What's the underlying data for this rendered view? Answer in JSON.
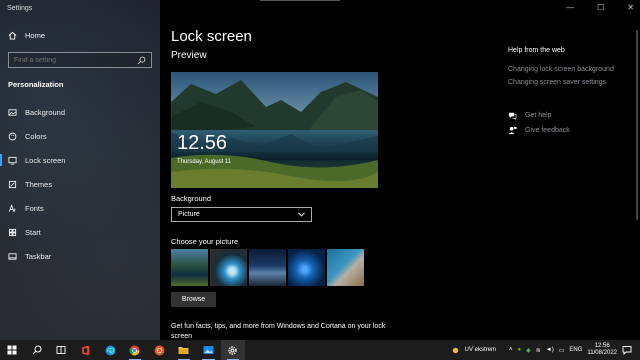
{
  "window": {
    "title": "Settings",
    "minimize_glyph": "—",
    "maximize_glyph": "☐",
    "close_glyph": "✕"
  },
  "sidebar": {
    "home_label": "Home",
    "search": {
      "placeholder": "Find a setting"
    },
    "section": "Personalization",
    "items": [
      {
        "label": "Background",
        "icon": "image-icon"
      },
      {
        "label": "Colors",
        "icon": "palette-icon"
      },
      {
        "label": "Lock screen",
        "icon": "lock-screen-icon",
        "active": true
      },
      {
        "label": "Themes",
        "icon": "brush-icon"
      },
      {
        "label": "Fonts",
        "icon": "font-icon"
      },
      {
        "label": "Start",
        "icon": "start-icon"
      },
      {
        "label": "Taskbar",
        "icon": "taskbar-icon"
      }
    ]
  },
  "main": {
    "title": "Lock screen",
    "preview_heading": "Preview",
    "preview_time": "12.56",
    "preview_date": "Thursday, August 11",
    "background_label": "Background",
    "background_value": "Picture",
    "choose_picture_label": "Choose your picture",
    "browse_label": "Browse",
    "fun_facts": "Get fun facts, tips, and more from Windows and Cortana on your lock screen"
  },
  "help": {
    "heading": "Help from the web",
    "links": [
      "Changing lock screen background",
      "Changing screen saver settings"
    ],
    "get_help": "Get help",
    "give_feedback": "Give feedback"
  },
  "taskbar": {
    "apps": [
      "windows-start-icon",
      "search-icon",
      "task-view-icon",
      "office-icon",
      "edge-icon",
      "chrome-icon",
      "ubuntu-icon",
      "file-explorer-icon",
      "photos-icon",
      "settings-icon"
    ],
    "weather": "UV ekstrem",
    "language": "ENG",
    "time": "12.56",
    "date": "11/08/2022"
  }
}
